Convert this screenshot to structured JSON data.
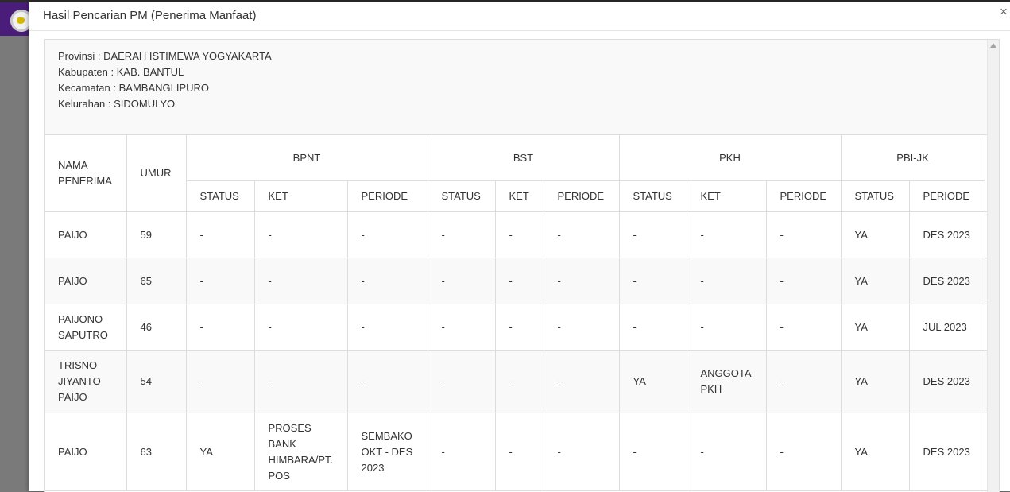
{
  "modal": {
    "title": "Hasil Pencarian PM (Penerima Manfaat)",
    "close_label": "×"
  },
  "location": {
    "lines": [
      "Provinsi : DAERAH ISTIMEWA YOGYAKARTA",
      "Kabupaten : KAB. BANTUL",
      "Kecamatan : BAMBANGLIPURO",
      "Kelurahan : SIDOMULYO"
    ]
  },
  "table": {
    "col_name": "NAMA PENERIMA",
    "col_age": "UMUR",
    "groups": [
      "BPNT",
      "BST",
      "PKH",
      "PBI-JK"
    ],
    "sub_headers": [
      "STATUS",
      "KET",
      "PERIODE",
      "STATUS",
      "KET",
      "PERIODE",
      "STATUS",
      "KET",
      "PERIODE",
      "STATUS",
      "PERIODE"
    ],
    "rows": [
      [
        "PAIJO",
        "59",
        "-",
        "-",
        "-",
        "-",
        "-",
        "-",
        "-",
        "-",
        "-",
        "YA",
        "DES 2023"
      ],
      [
        "PAIJO",
        "65",
        "-",
        "-",
        "-",
        "-",
        "-",
        "-",
        "-",
        "-",
        "-",
        "YA",
        "DES 2023"
      ],
      [
        "PAIJONO SAPUTRO",
        "46",
        "-",
        "-",
        "-",
        "-",
        "-",
        "-",
        "-",
        "-",
        "-",
        "YA",
        "JUL 2023"
      ],
      [
        "TRISNO JIYANTO PAIJO",
        "54",
        "-",
        "-",
        "-",
        "-",
        "-",
        "-",
        "YA",
        "ANGGOTA PKH",
        "-",
        "YA",
        "DES 2023"
      ],
      [
        "PAIJO",
        "63",
        "YA",
        "PROSES BANK HIMBARA/PT. POS",
        "SEMBAKO OKT - DES 2023",
        "-",
        "-",
        "-",
        "-",
        "-",
        "-",
        "YA",
        "DES 2023"
      ]
    ]
  }
}
